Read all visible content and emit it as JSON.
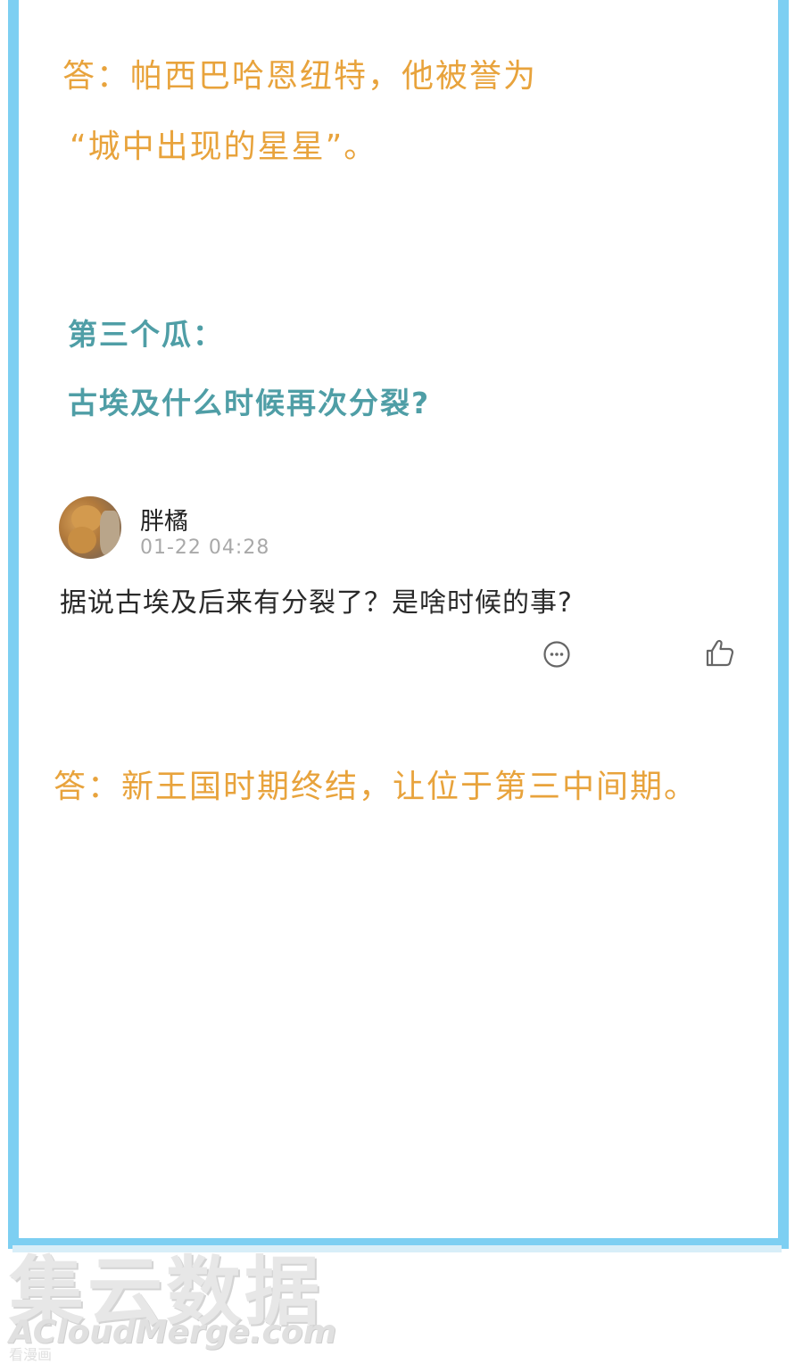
{
  "answer1": {
    "line1": "答：帕西巴哈恩纽特，他被誉为",
    "line2": "“城中出现的星星”。"
  },
  "question3": {
    "heading": "第三个瓜：",
    "text": "古埃及什么时候再次分裂?"
  },
  "post": {
    "username": "胖橘",
    "timestamp": "01-22 04:28",
    "content": "据说古埃及后来有分裂了？是啥时候的事?",
    "comment_icon": "comment-icon",
    "like_icon": "thumbs-up-icon"
  },
  "answer2": {
    "text": "答：新王国时期终结，让位于第三中间期。"
  },
  "watermark": {
    "chinese": "集云数据",
    "english": "ACloudMerge.com",
    "small": "看漫画"
  },
  "colors": {
    "frame": "#7dcff2",
    "answer": "#e8a33c",
    "question": "#4f9ea6"
  }
}
